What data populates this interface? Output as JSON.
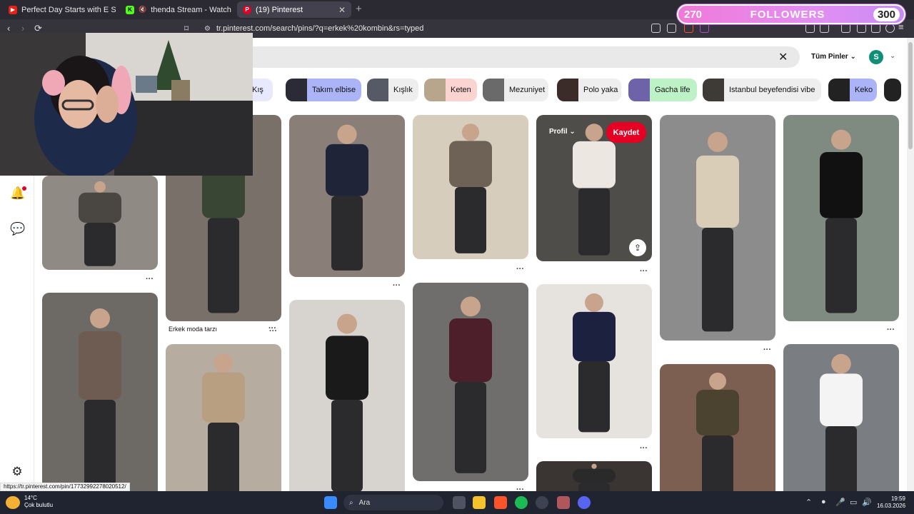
{
  "tabs": [
    {
      "title": "Perfect Day Starts with E S P R E S S",
      "favicon_color": "#e62117"
    },
    {
      "title": "thenda Stream - Watch Live on K",
      "favicon_color": "#53fc18",
      "favicon_glyph": "K"
    },
    {
      "title": "(19) Pinterest",
      "favicon_color": "#e60023",
      "close": "✕"
    }
  ],
  "newtab": "+",
  "address": {
    "url": "tr.pinterest.com/search/pins/?q=erkek%20kombin&rs=typed"
  },
  "nav": {
    "back": "‹",
    "forward": "›",
    "reload": "⟳"
  },
  "followers_overlay": {
    "current": "270",
    "label": "FOLLOWERS",
    "goal": "300"
  },
  "header": {
    "clear": "✕",
    "filter": "Tüm Pinler",
    "avatar_initial": "S"
  },
  "chips": [
    {
      "label": "Kış",
      "color": "#e8e8ff",
      "thumb": "#a9a9c9"
    },
    {
      "label": "Takım elbise",
      "color": "#aab4f7",
      "thumb": "#2b2b38"
    },
    {
      "label": "Kışlık",
      "color": "#eeeeee",
      "thumb": "#555a66"
    },
    {
      "label": "Keten",
      "color": "#fbd3d0",
      "thumb": "#b7a58c"
    },
    {
      "label": "Mezuniyet",
      "color": "#eeeeee",
      "thumb": "#6a6a6a"
    },
    {
      "label": "Polo yaka",
      "color": "#eeeeee",
      "thumb": "#3b2c2a"
    },
    {
      "label": "Gacha life",
      "color": "#bdf2c6",
      "thumb": "#6e63a8"
    },
    {
      "label": "Istanbul beyefendisi vibe",
      "color": "#eeeeee",
      "thumb": "#3e3a36"
    },
    {
      "label": "Keko",
      "color": "#aab4f7",
      "thumb": "#222222"
    }
  ],
  "pins": [
    {
      "col": 0,
      "color": "#8f8b84",
      "accent": "#4a4743"
    },
    {
      "col": 0,
      "color": "#6d6a66",
      "accent": "#6e5b52"
    },
    {
      "col": 1,
      "color": "#79706a",
      "accent": "#3a4634",
      "title": "Erkek moda tarzı"
    },
    {
      "col": 1,
      "color": "#b7aca0",
      "accent": "#b89f82"
    },
    {
      "col": 2,
      "color": "#8a7f78",
      "accent": "#1f2438"
    },
    {
      "col": 2,
      "color": "#d7d3cf",
      "accent": "#1a1a1a"
    },
    {
      "col": 3,
      "color": "#d6cdbd",
      "accent": "#6e6256"
    },
    {
      "col": 3,
      "color": "#6f6e6d",
      "accent": "#4d1f2a"
    },
    {
      "col": 4,
      "color": "#4f4d4a",
      "accent": "#ece8e1"
    },
    {
      "col": 4,
      "color": "#e6e3df",
      "accent": "#1c2140"
    },
    {
      "col": 4,
      "color": "#3a3433",
      "accent": "#2a2a2a"
    },
    {
      "col": 5,
      "color": "#8c8c8c",
      "accent": "#d9cdb8"
    },
    {
      "col": 5,
      "color": "#7c5f50",
      "accent": "#4b4330"
    },
    {
      "col": 6,
      "color": "#7f8a80",
      "accent": "#111111"
    },
    {
      "col": 6,
      "color": "#7a7d82",
      "accent": "#f4f4f4"
    }
  ],
  "hover_pin": {
    "profile": "Profil",
    "save": "Kaydet"
  },
  "status_url": "https://tr.pinterest.com/pin/17732992278020512/",
  "taskbar": {
    "temp": "14°C",
    "weather": "Çok bulutlu",
    "search": "Ara",
    "time": "19:59",
    "date": "16.03.2026"
  }
}
